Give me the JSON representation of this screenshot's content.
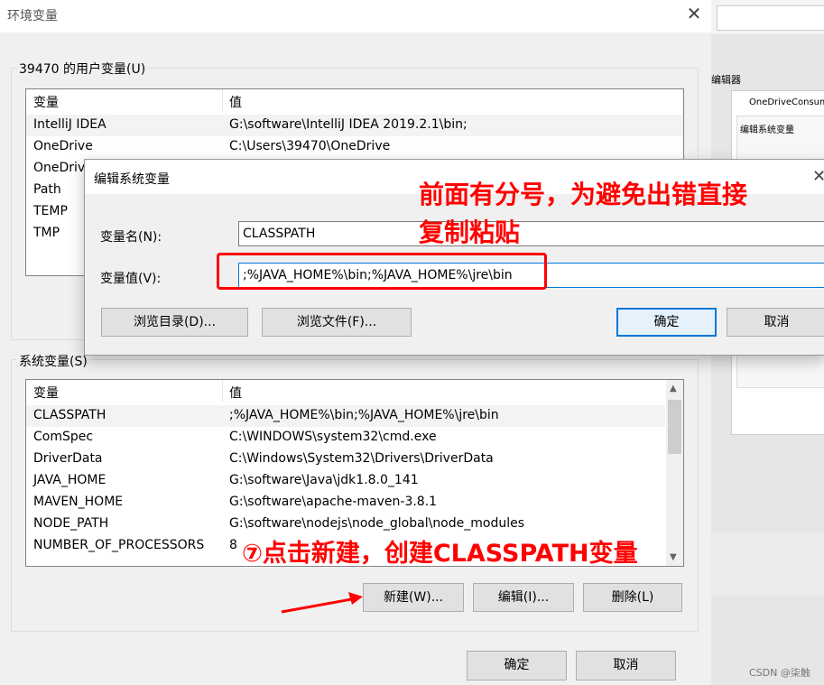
{
  "window": {
    "title": "环境变量",
    "close": "✕",
    "user_group_label": "39470 的用户变量(U)",
    "system_group_label": "系统变量(S)"
  },
  "user_vars": {
    "col_name": "变量",
    "col_value": "值",
    "rows": [
      {
        "name": "IntelliJ IDEA",
        "value": "G:\\software\\IntelliJ IDEA 2019.2.1\\bin;"
      },
      {
        "name": "OneDrive",
        "value": "C:\\Users\\39470\\OneDrive"
      },
      {
        "name": "OneDrive",
        "value": ""
      },
      {
        "name": "Path",
        "value": ""
      },
      {
        "name": "TEMP",
        "value": ""
      },
      {
        "name": "TMP",
        "value": ""
      }
    ]
  },
  "system_vars": {
    "col_name": "变量",
    "col_value": "值",
    "rows": [
      {
        "name": "CLASSPATH",
        "value": ";%JAVA_HOME%\\bin;%JAVA_HOME%\\jre\\bin"
      },
      {
        "name": "ComSpec",
        "value": "C:\\WINDOWS\\system32\\cmd.exe"
      },
      {
        "name": "DriverData",
        "value": "C:\\Windows\\System32\\Drivers\\DriverData"
      },
      {
        "name": "JAVA_HOME",
        "value": "G:\\software\\Java\\jdk1.8.0_141"
      },
      {
        "name": "MAVEN_HOME",
        "value": "G:\\software\\apache-maven-3.8.1"
      },
      {
        "name": "NODE_PATH",
        "value": "G:\\software\\nodejs\\node_global\\node_modules"
      },
      {
        "name": "NUMBER_OF_PROCESSORS",
        "value": "8"
      }
    ],
    "buttons": {
      "new": "新建(W)...",
      "edit": "编辑(I)...",
      "delete": "删除(L)"
    }
  },
  "footer": {
    "ok": "确定",
    "cancel": "取消"
  },
  "edit_dialog": {
    "title": "编辑系统变量",
    "close": "✕",
    "name_label": "变量名(N):",
    "name_value": "CLASSPATH",
    "value_label": "变量值(V):",
    "value_value": ";%JAVA_HOME%\\bin;%JAVA_HOME%\\jre\\bin",
    "browse_dir": "浏览目录(D)...",
    "browse_file": "浏览文件(F)...",
    "ok": "确定",
    "cancel": "取消"
  },
  "background_window": {
    "title_fragment": "编辑器",
    "item": "OneDriveConsume",
    "mini_dialog_title": "编辑系统变量"
  },
  "annotations": {
    "note_semicolon": "前面有分号，为避免出错直接",
    "note_semicolon_2": "复制粘贴",
    "step7": "⑦点击新建，创建CLASSPATH变量",
    "accent_color": "#ff0000"
  },
  "watermark": "CSDN @柒触"
}
